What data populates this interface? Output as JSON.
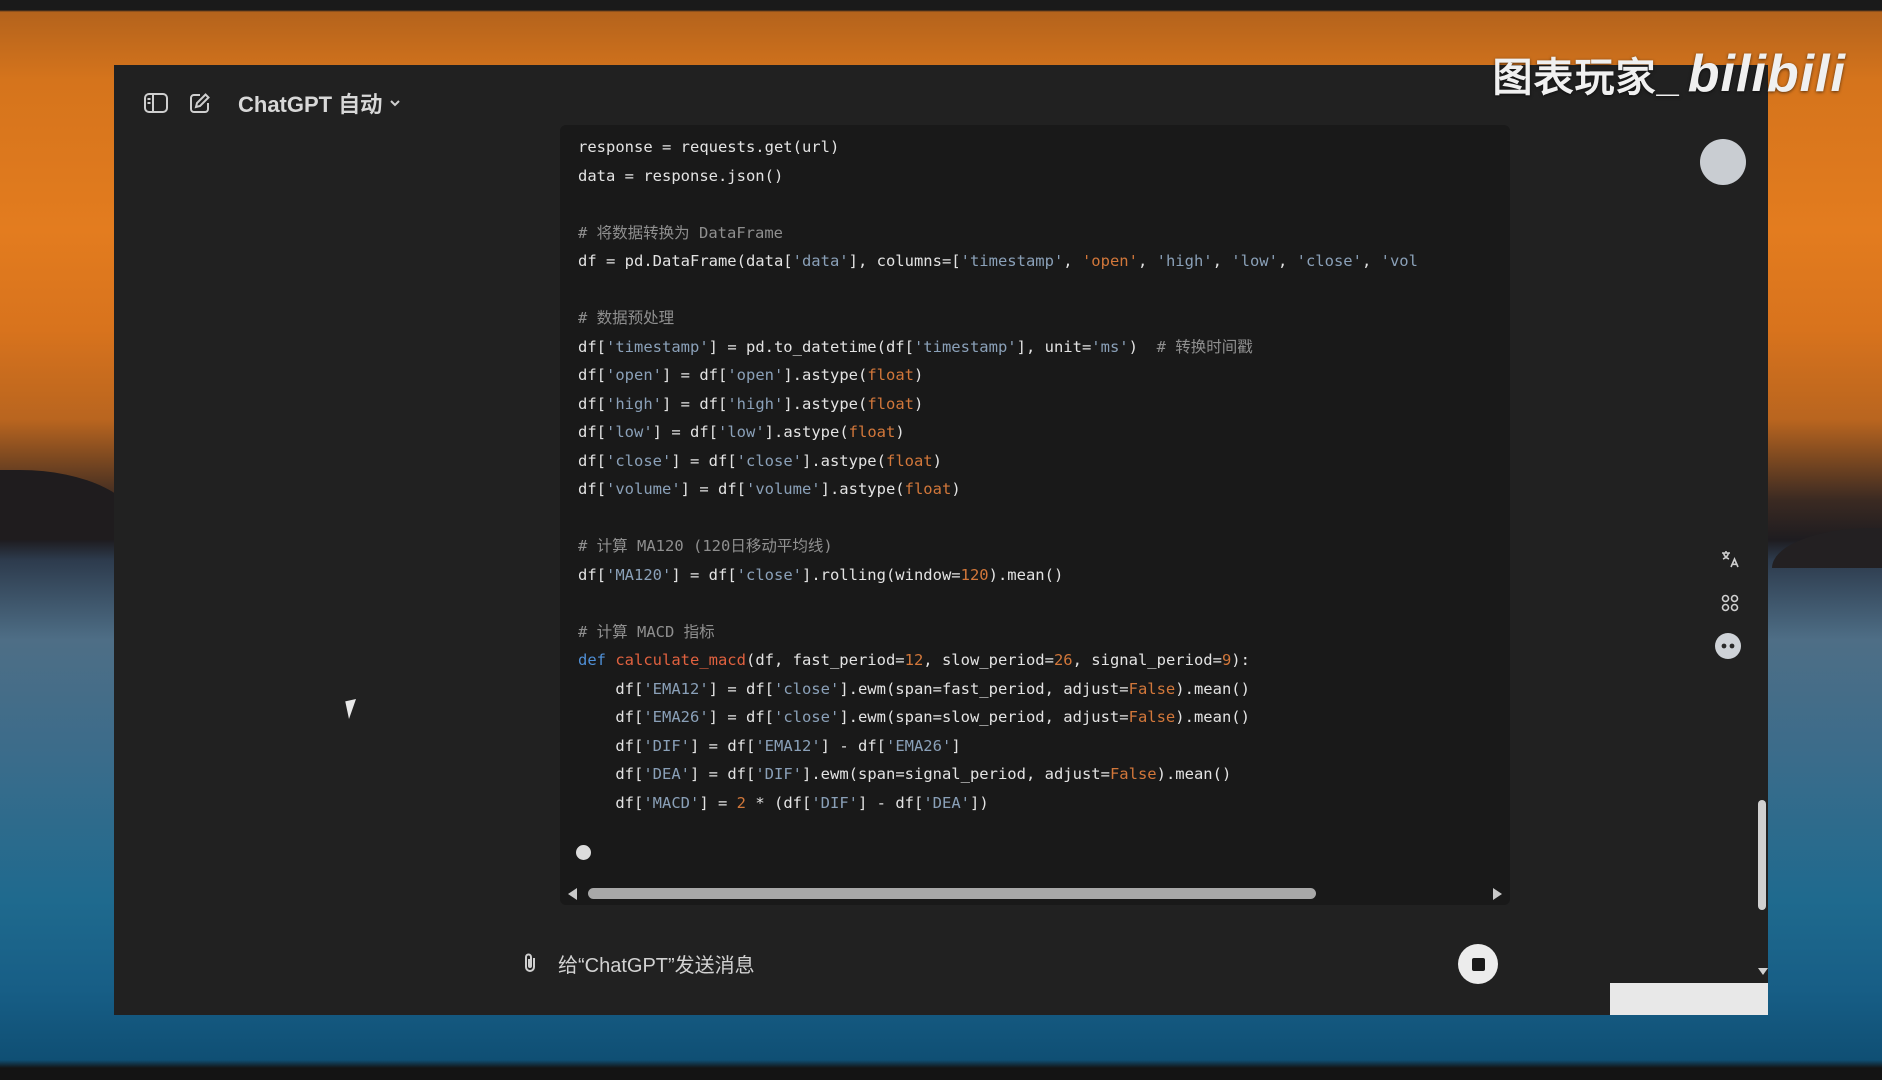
{
  "watermark": {
    "text": "图表玩家_",
    "logo": "bilibili"
  },
  "header": {
    "sidebar_toggle_icon": "sidebar-icon",
    "new_chat_icon": "edit-icon",
    "model_label": "ChatGPT 自动",
    "model_chevron_icon": "chevron-down-icon"
  },
  "code_block": {
    "language": "python",
    "lines": [
      [
        {
          "t": "response = requests.get(url)"
        }
      ],
      [
        {
          "t": "data = response.json()"
        }
      ],
      [],
      [
        {
          "t": "# 将数据转换为 DataFrame",
          "c": "c"
        }
      ],
      [
        {
          "t": "df = pd.DataFrame(data["
        },
        {
          "t": "'data'",
          "c": "s"
        },
        {
          "t": "], columns=["
        },
        {
          "t": "'timestamp'",
          "c": "s"
        },
        {
          "t": ", "
        },
        {
          "t": "'open'",
          "c": "n"
        },
        {
          "t": ", "
        },
        {
          "t": "'high'",
          "c": "s"
        },
        {
          "t": ", "
        },
        {
          "t": "'low'",
          "c": "s"
        },
        {
          "t": ", "
        },
        {
          "t": "'close'",
          "c": "s"
        },
        {
          "t": ", "
        },
        {
          "t": "'vol",
          "c": "s"
        }
      ],
      [],
      [
        {
          "t": "# 数据预处理",
          "c": "c"
        }
      ],
      [
        {
          "t": "df["
        },
        {
          "t": "'timestamp'",
          "c": "s"
        },
        {
          "t": "] = pd.to_datetime(df["
        },
        {
          "t": "'timestamp'",
          "c": "s"
        },
        {
          "t": "], unit="
        },
        {
          "t": "'ms'",
          "c": "s"
        },
        {
          "t": ")  "
        },
        {
          "t": "# 转换时间戳",
          "c": "c"
        }
      ],
      [
        {
          "t": "df["
        },
        {
          "t": "'open'",
          "c": "s"
        },
        {
          "t": "] = df["
        },
        {
          "t": "'open'",
          "c": "s"
        },
        {
          "t": "].astype("
        },
        {
          "t": "float",
          "c": "n"
        },
        {
          "t": ")"
        }
      ],
      [
        {
          "t": "df["
        },
        {
          "t": "'high'",
          "c": "s"
        },
        {
          "t": "] = df["
        },
        {
          "t": "'high'",
          "c": "s"
        },
        {
          "t": "].astype("
        },
        {
          "t": "float",
          "c": "n"
        },
        {
          "t": ")"
        }
      ],
      [
        {
          "t": "df["
        },
        {
          "t": "'low'",
          "c": "s"
        },
        {
          "t": "] = df["
        },
        {
          "t": "'low'",
          "c": "s"
        },
        {
          "t": "].astype("
        },
        {
          "t": "float",
          "c": "n"
        },
        {
          "t": ")"
        }
      ],
      [
        {
          "t": "df["
        },
        {
          "t": "'close'",
          "c": "s"
        },
        {
          "t": "] = df["
        },
        {
          "t": "'close'",
          "c": "s"
        },
        {
          "t": "].astype("
        },
        {
          "t": "float",
          "c": "n"
        },
        {
          "t": ")"
        }
      ],
      [
        {
          "t": "df["
        },
        {
          "t": "'volume'",
          "c": "s"
        },
        {
          "t": "] = df["
        },
        {
          "t": "'volume'",
          "c": "s"
        },
        {
          "t": "].astype("
        },
        {
          "t": "float",
          "c": "n"
        },
        {
          "t": ")"
        }
      ],
      [],
      [
        {
          "t": "# 计算 MA120 (120日移动平均线)",
          "c": "c"
        }
      ],
      [
        {
          "t": "df["
        },
        {
          "t": "'MA120'",
          "c": "s"
        },
        {
          "t": "] = df["
        },
        {
          "t": "'close'",
          "c": "s"
        },
        {
          "t": "].rolling(window="
        },
        {
          "t": "120",
          "c": "n"
        },
        {
          "t": ").mean()"
        }
      ],
      [],
      [
        {
          "t": "# 计算 MACD 指标",
          "c": "c"
        }
      ],
      [
        {
          "t": "def ",
          "c": "k"
        },
        {
          "t": "calculate_macd",
          "c": "f"
        },
        {
          "t": "(df, fast_period="
        },
        {
          "t": "12",
          "c": "n"
        },
        {
          "t": ", slow_period="
        },
        {
          "t": "26",
          "c": "n"
        },
        {
          "t": ", signal_period="
        },
        {
          "t": "9",
          "c": "n"
        },
        {
          "t": "):"
        }
      ],
      [
        {
          "t": "    df["
        },
        {
          "t": "'EMA12'",
          "c": "s"
        },
        {
          "t": "] = df["
        },
        {
          "t": "'close'",
          "c": "s"
        },
        {
          "t": "].ewm(span=fast_period, adjust="
        },
        {
          "t": "False",
          "c": "n"
        },
        {
          "t": ").mean()"
        }
      ],
      [
        {
          "t": "    df["
        },
        {
          "t": "'EMA26'",
          "c": "s"
        },
        {
          "t": "] = df["
        },
        {
          "t": "'close'",
          "c": "s"
        },
        {
          "t": "].ewm(span=slow_period, adjust="
        },
        {
          "t": "False",
          "c": "n"
        },
        {
          "t": ").mean()"
        }
      ],
      [
        {
          "t": "    df["
        },
        {
          "t": "'DIF'",
          "c": "s"
        },
        {
          "t": "] = df["
        },
        {
          "t": "'EMA12'",
          "c": "s"
        },
        {
          "t": "] - df["
        },
        {
          "t": "'EMA26'",
          "c": "s"
        },
        {
          "t": "]"
        }
      ],
      [
        {
          "t": "    df["
        },
        {
          "t": "'DEA'",
          "c": "s"
        },
        {
          "t": "] = df["
        },
        {
          "t": "'DIF'",
          "c": "s"
        },
        {
          "t": "].ewm(span=signal_period, adjust="
        },
        {
          "t": "False",
          "c": "n"
        },
        {
          "t": ").mean()"
        }
      ],
      [
        {
          "t": "    df["
        },
        {
          "t": "'MACD'",
          "c": "s"
        },
        {
          "t": "] = "
        },
        {
          "t": "2",
          "c": "n"
        },
        {
          "t": " * (df["
        },
        {
          "t": "'DIF'",
          "c": "s"
        },
        {
          "t": "] - df["
        },
        {
          "t": "'DEA'",
          "c": "s"
        },
        {
          "t": "])"
        }
      ]
    ],
    "horizontal_scroll": {
      "position": 0.0,
      "visible_fraction": 0.78
    }
  },
  "side_tools": {
    "translate_icon": "translate-icon",
    "apps_icon": "grid-icon",
    "assistant_icon": "bot-icon"
  },
  "composer": {
    "attach_icon": "paperclip-icon",
    "placeholder": "给“ChatGPT”发送消息",
    "value": "",
    "stop_icon": "stop-icon"
  },
  "colors": {
    "window_bg": "#212121",
    "code_bg": "#191919",
    "string": "#8aa0b8",
    "number": "#d2773a",
    "keyword": "#4f8fd6",
    "function": "#e0613f",
    "comment": "#8f8f8f"
  }
}
